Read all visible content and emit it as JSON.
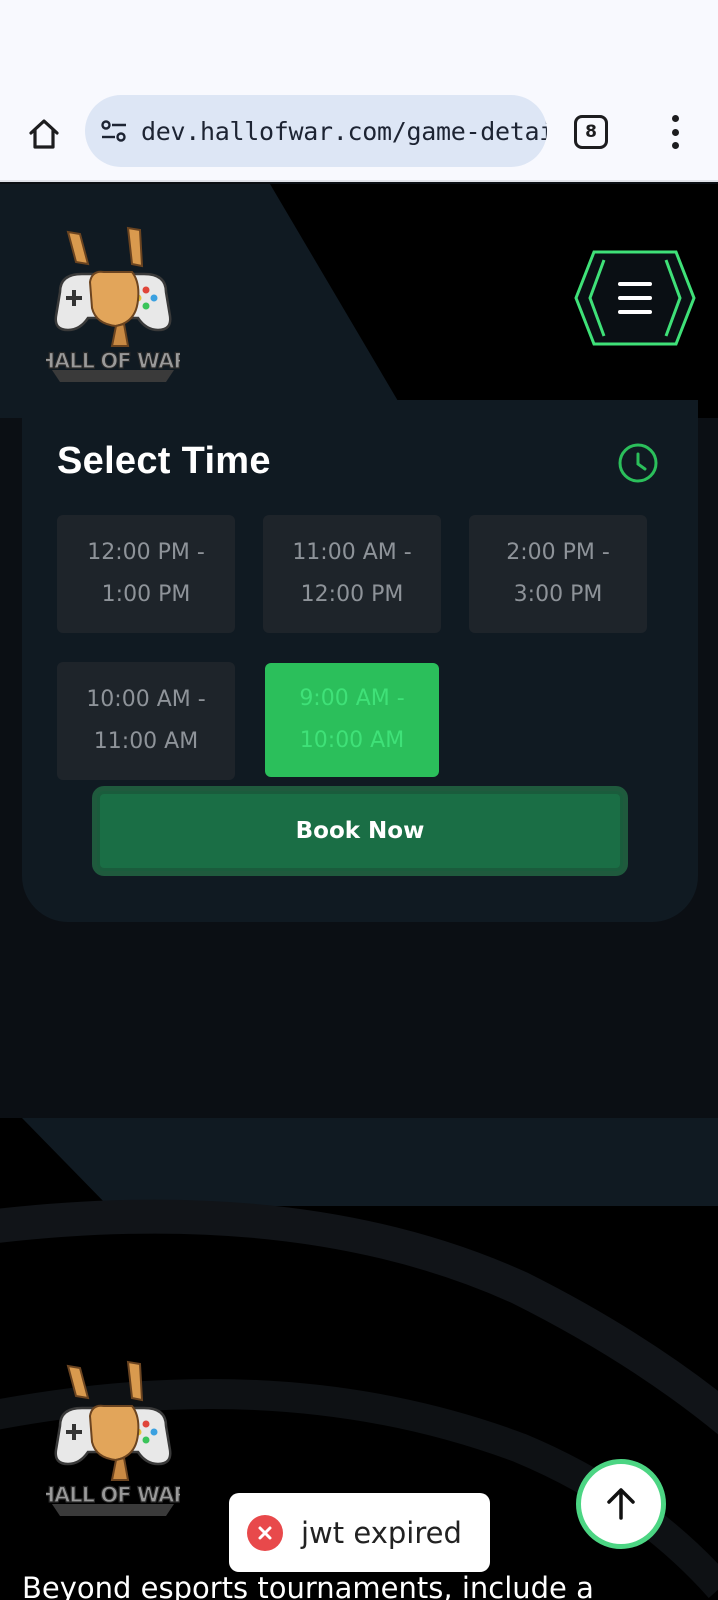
{
  "browser": {
    "url": "dev.hallofwar.com/game-detai",
    "tab_count": "8"
  },
  "brand": {
    "logo_text": "HALL OF WAR",
    "accent_color": "#2bbf5b"
  },
  "booking": {
    "title": "Select Time",
    "slots": [
      {
        "line1": "12:00 PM -",
        "line2": "1:00 PM",
        "selected": false
      },
      {
        "line1": "11:00 AM -",
        "line2": "12:00 PM",
        "selected": false
      },
      {
        "line1": "2:00 PM -",
        "line2": "3:00 PM",
        "selected": false
      },
      {
        "line1": "10:00 AM -",
        "line2": "11:00 AM",
        "selected": false
      },
      {
        "line1": "9:00 AM -",
        "line2": "10:00 AM",
        "selected": true
      }
    ],
    "book_label": "Book Now"
  },
  "footer": {
    "description": "Beyond esports tournaments, include a"
  },
  "toast": {
    "message": "jwt expired"
  }
}
